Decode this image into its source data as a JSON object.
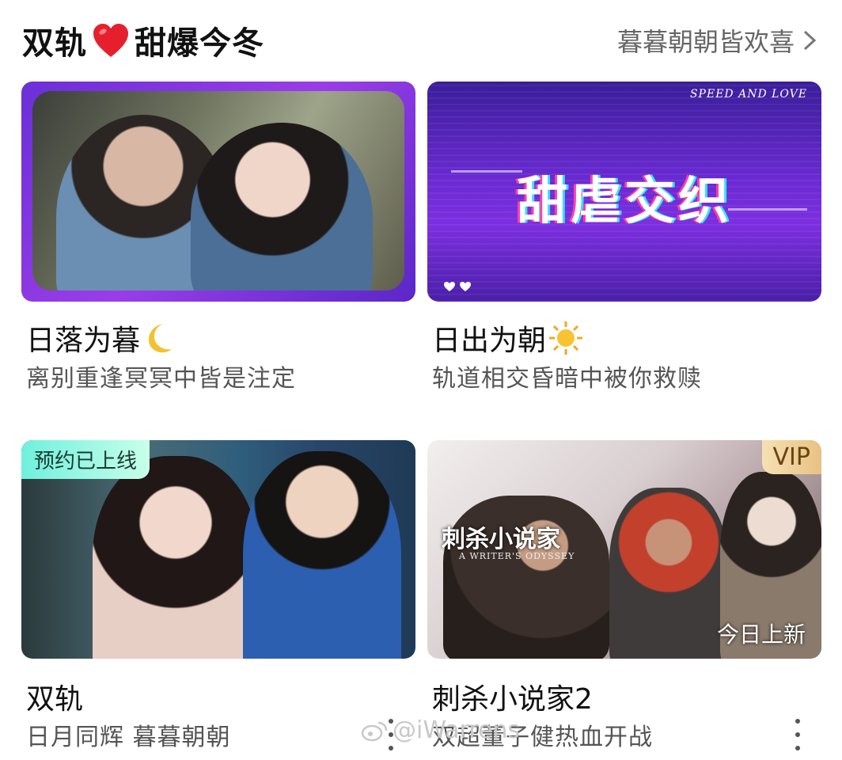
{
  "header": {
    "title_left": "双轨",
    "title_emoji": "heart-emoji",
    "title_right": "甜爆今冬",
    "more_label": "暮暮朝朝皆欢喜"
  },
  "cards": [
    {
      "title": "日落为暮",
      "title_emoji": "crescent-moon-icon",
      "subtitle": "离别重逢冥冥中皆是注定"
    },
    {
      "title": "日出为朝",
      "title_emoji": "sun-icon",
      "subtitle": "轨道相交昏暗中被你救赎",
      "overlay_script": "SPEED AND LOVE",
      "overlay_text": "甜虐交织"
    },
    {
      "badge": "预约已上线",
      "title": "双轨",
      "subtitle": "日月同辉 暮暮朝朝"
    },
    {
      "badge": "VIP",
      "poster_logo": "刺杀小说家",
      "poster_logo_sub": "A WRITER'S ODYSSEY",
      "corner_label": "今日上新",
      "title": "刺杀小说家2",
      "subtitle": "双超董子健热血开战"
    }
  ],
  "watermark": "@iWarrens",
  "colors": {
    "accent_purple": "#7a2fe0",
    "reserve_badge": "#6ff0dd",
    "vip_badge": "#e8c283"
  }
}
